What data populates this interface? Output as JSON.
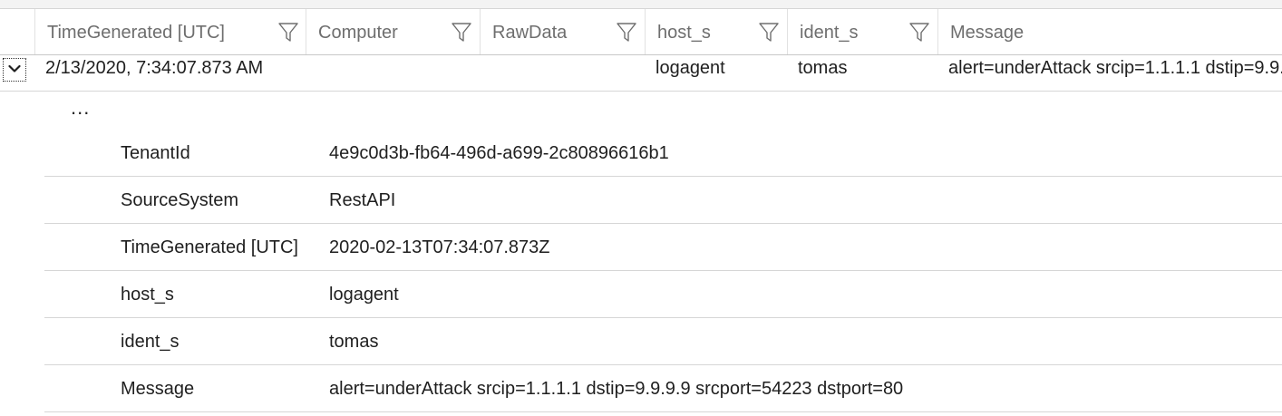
{
  "columns": [
    {
      "label": "TimeGenerated [UTC]"
    },
    {
      "label": "Computer"
    },
    {
      "label": "RawData"
    },
    {
      "label": "host_s"
    },
    {
      "label": "ident_s"
    },
    {
      "label": "Message"
    }
  ],
  "row": {
    "expanded": true,
    "time_generated": "2/13/2020, 7:34:07.873 AM",
    "computer": "",
    "raw_data": "",
    "host_s": "logagent",
    "ident_s": "tomas",
    "message": "alert=underAttack srcip=1.1.1.1 dstip=9.9.9.9 srcport=54223 dstport=80"
  },
  "detail": {
    "ellipsis": "...",
    "fields": [
      {
        "key": "TenantId",
        "value": "4e9c0d3b-fb64-496d-a699-2c80896616b1"
      },
      {
        "key": "SourceSystem",
        "value": "RestAPI"
      },
      {
        "key": "TimeGenerated [UTC]",
        "value": "2020-02-13T07:34:07.873Z"
      },
      {
        "key": "host_s",
        "value": "logagent"
      },
      {
        "key": "ident_s",
        "value": "tomas"
      },
      {
        "key": "Message",
        "value": "alert=underAttack srcip=1.1.1.1 dstip=9.9.9.9 srcport=54223 dstport=80"
      }
    ]
  },
  "icons": {
    "filter": "filter-funnel-icon",
    "expand": "chevron-down-icon"
  }
}
